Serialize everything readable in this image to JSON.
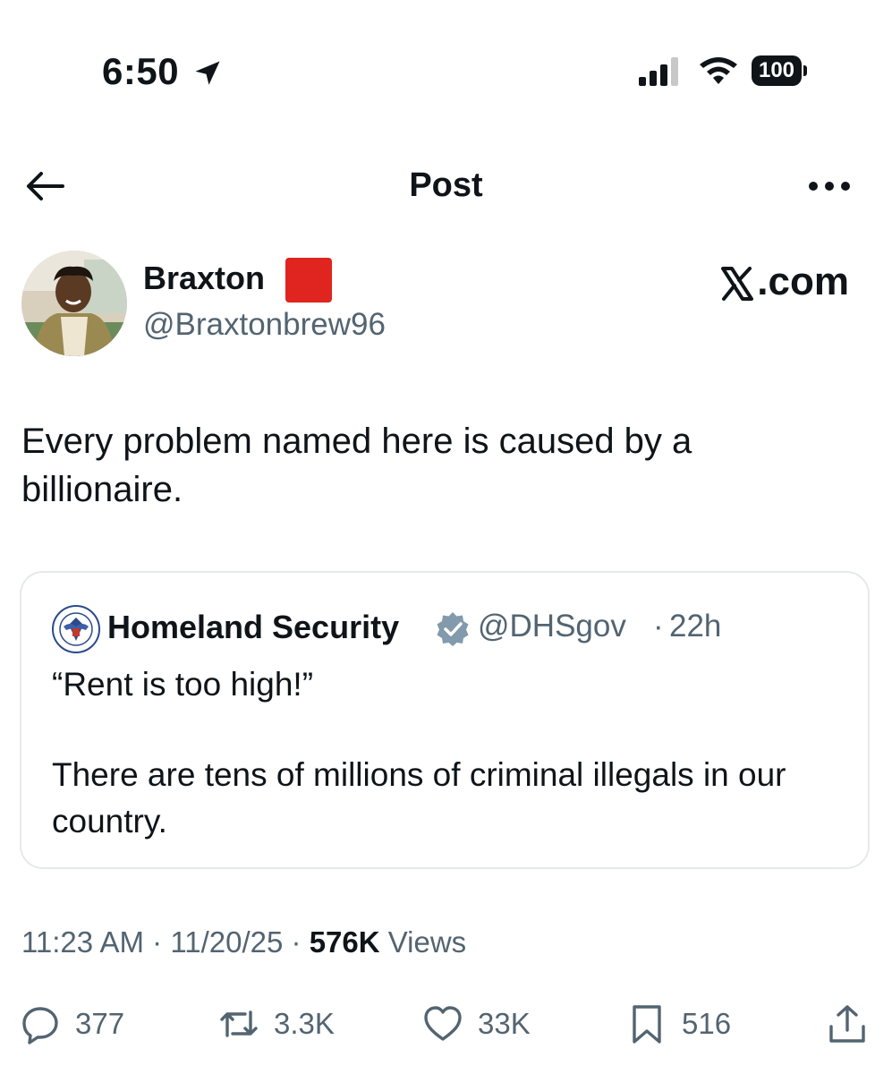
{
  "status_bar": {
    "time": "6:50",
    "battery": "100",
    "icons": [
      "location-arrow-icon",
      "cellular-signal-icon",
      "wifi-icon",
      "battery-icon"
    ]
  },
  "nav": {
    "title": "Post",
    "back_icon": "back-arrow-icon",
    "more_icon": "more-options-icon"
  },
  "author": {
    "display_name": "Braxton",
    "emoji": "red-square",
    "handle": "@Braxtonbrew96"
  },
  "watermark": {
    "text": ".com",
    "logo_letter": "X"
  },
  "tweet": {
    "text": "Every problem named here is caused by a billionaire."
  },
  "quote": {
    "name": "Homeland Security",
    "handle": "@DHSgov",
    "separator": "·",
    "time": "22h",
    "line1": "“Rent is too high!”",
    "line2": "There are tens of millions of criminal illegals in our country.",
    "badge": "verified-gray-badge"
  },
  "meta": {
    "time": "11:23 AM",
    "sep1": "·",
    "date": "11/20/25",
    "sep2": "·",
    "views_count": "576K",
    "views_label": "Views"
  },
  "actions": {
    "replies": "377",
    "reposts": "3.3K",
    "likes": "33K",
    "bookmarks": "516"
  },
  "colors": {
    "text": "#0f1419",
    "secondary": "#536471",
    "border": "#e6e9ec",
    "flag": "#e0241f"
  }
}
